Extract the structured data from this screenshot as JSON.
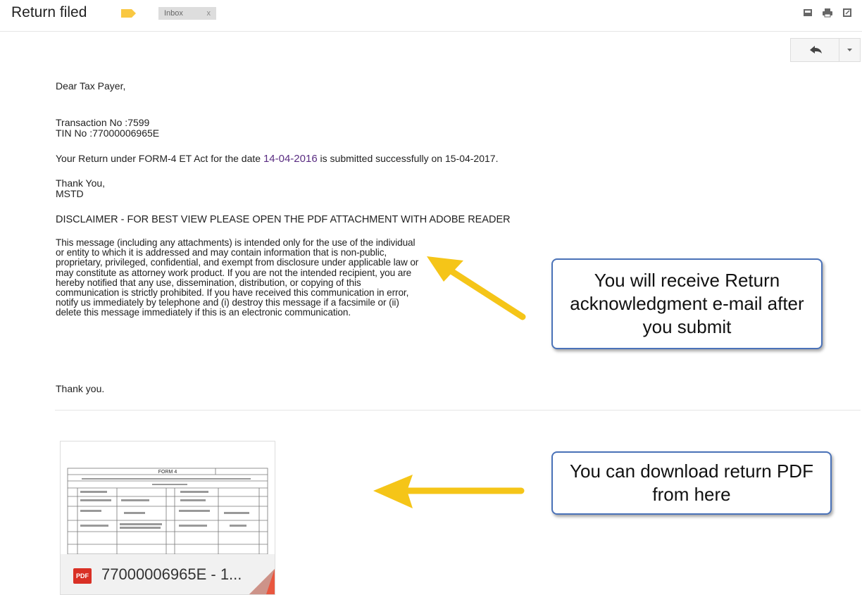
{
  "header": {
    "subject": "Return filed",
    "label": "Inbox",
    "label_close": "x",
    "icons": [
      "print-all-icon",
      "print-icon",
      "new-window-icon"
    ]
  },
  "actions": {
    "reply_icon": "reply-icon",
    "more_icon": "chevron-down-icon"
  },
  "email": {
    "greeting": "Dear Tax Payer,",
    "transaction_line": "Transaction No :7599",
    "tin_line": "TIN No :77000006965E",
    "return_prefix": "Your Return under FORM-4 ET Act for the date ",
    "return_date": "14-04-2016",
    "return_suffix": " is submitted successfully on 15-04-2017.",
    "thanks_line": "Thank You,",
    "sender": "MSTD",
    "disclaimer_heading": "DISCLAIMER - FOR BEST VIEW PLEASE OPEN THE PDF ATTACHMENT WITH ADOBE READER",
    "disclaimer_text": "This message (including any attachments) is intended only for the use of the individual or entity to which it is addressed and may contain information that is non-public, proprietary, privileged, confidential, and exempt from disclosure under applicable law or may constitute as attorney work product. If you are not the intended recipient, you are hereby notified that any use, dissemination, distribution, or copying of this communication is strictly prohibited. If you have received this communication in error, notify us immediately by telephone and (i) destroy this message if a facsimile or (ii) delete this message immediately if this is an electronic communication.",
    "closing": "Thank you."
  },
  "callouts": {
    "ack": "You will receive Return acknowledgment e-mail after you submit",
    "download": "You can download return PDF from here"
  },
  "attachment": {
    "badge": "PDF",
    "filename": "77000006965E - 1...",
    "preview_title": "FORM 4"
  },
  "colors": {
    "arrow": "#f5c518",
    "callout_border": "#4a72b8",
    "date_link": "#5a2d82",
    "pdf_red": "#d93025",
    "tag": "#f9c842"
  }
}
